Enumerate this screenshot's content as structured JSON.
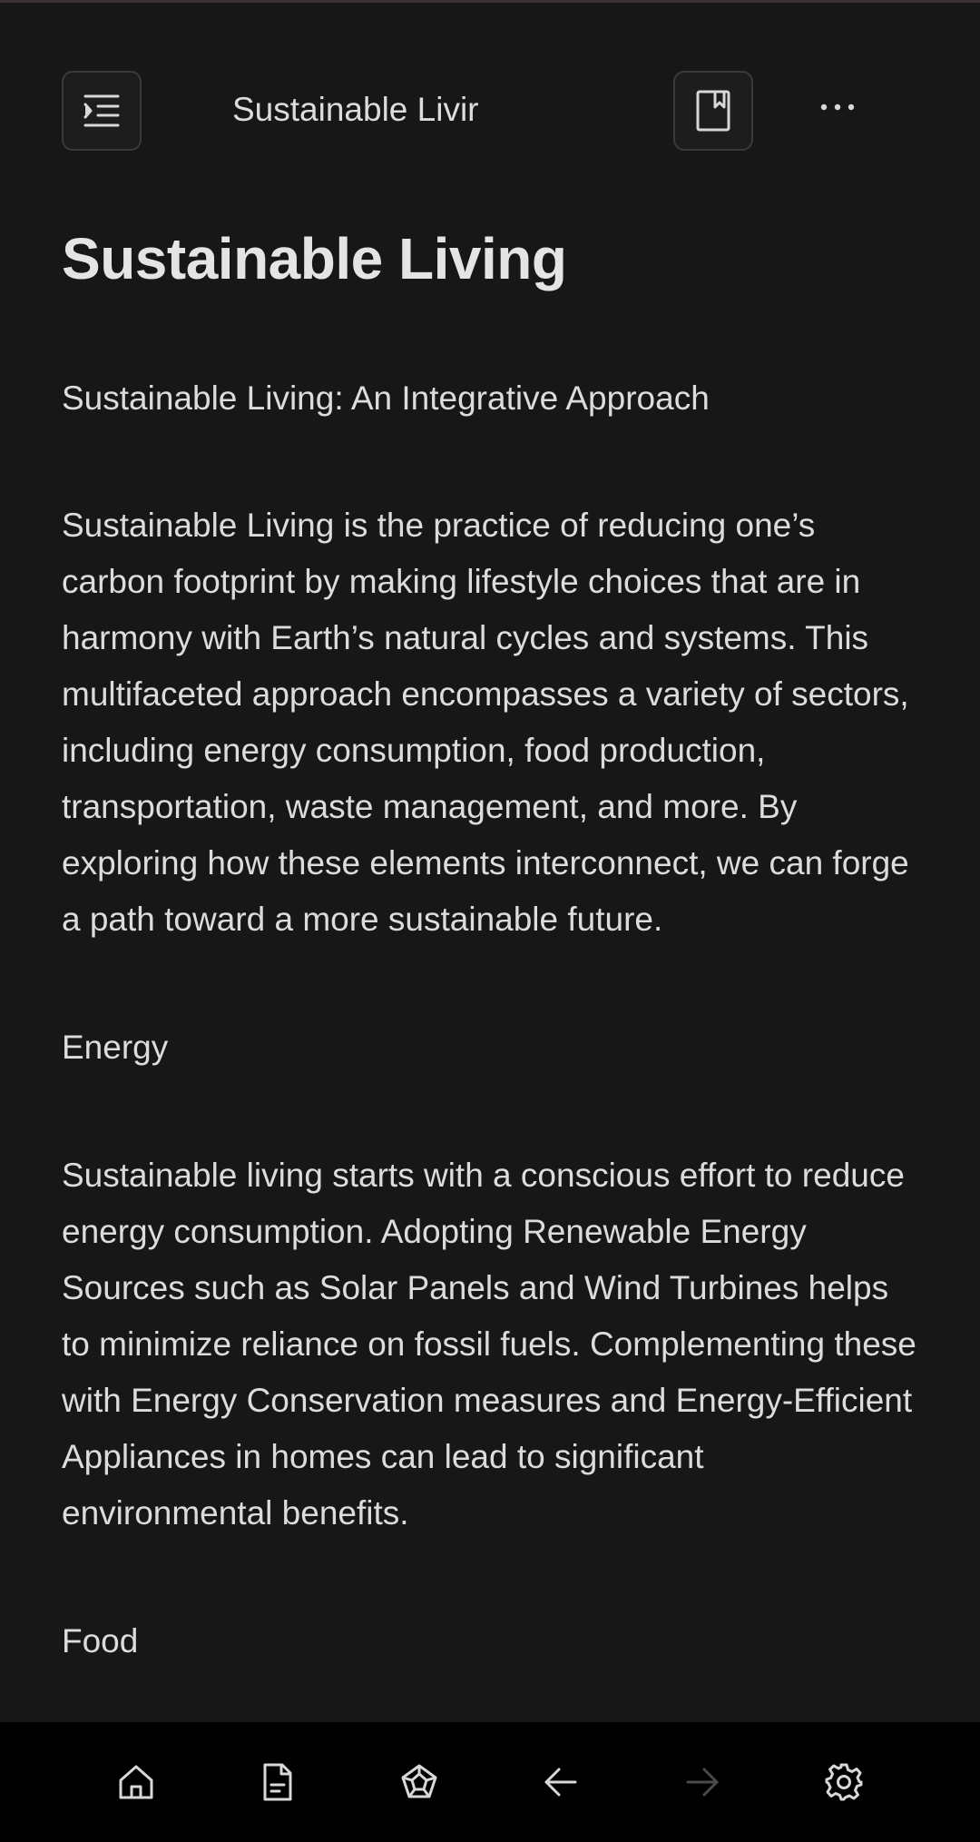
{
  "header": {
    "title": "Sustainable Livir"
  },
  "document": {
    "title": "Sustainable Living",
    "subtitle": "Sustainable Living: An Integrative Approach",
    "intro": "Sustainable Living is the practice of reducing one’s carbon footprint by making lifestyle choices that are in harmony with Earth’s natural cycles and systems. This multifaceted approach encompasses a variety of sectors, including energy consumption, food production, transportation, waste management, and more. By exploring how these elements interconnect, we can forge a path toward a more sustainable future.",
    "energy_heading": "Energy",
    "energy_text": "Sustainable living starts with a conscious effort to reduce energy consumption. Adopting Renewable Energy Sources such as Solar Panels and Wind Turbines helps to minimize reliance on fossil fuels. Complementing these with Energy Conservation measures and Energy-Efficient Appliances in homes can lead to significant environmental benefits.",
    "food_heading": "Food"
  },
  "icons": {
    "outline": "outline-indent-icon",
    "bookmark": "bookmark-icon",
    "more": "more-horizontal-icon",
    "home": "home-icon",
    "file": "file-icon",
    "graph": "graph-icon",
    "back": "arrow-left-icon",
    "forward": "arrow-right-icon",
    "settings": "gear-icon"
  },
  "colors": {
    "background": "#171717",
    "text": "#dcdcdc",
    "nav_background": "#000000",
    "icon": "#d8d8d8",
    "icon_disabled": "#4a4a4a"
  }
}
